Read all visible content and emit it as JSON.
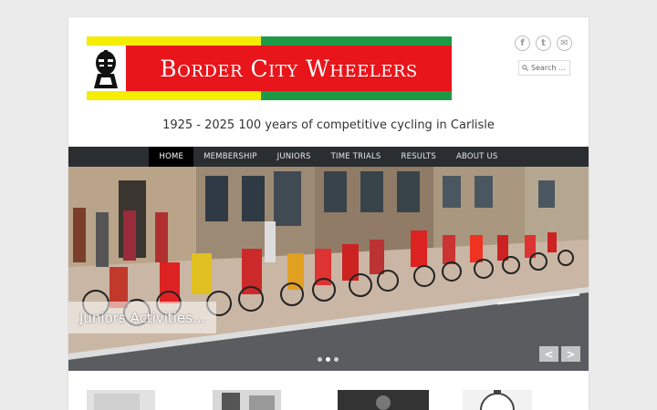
{
  "site": {
    "title": "Border City Wheelers",
    "tagline": "1925 - 2025 100 years of competitive cycling in Carlisle"
  },
  "social": [
    {
      "name": "facebook-icon",
      "glyph": "f"
    },
    {
      "name": "twitter-icon",
      "glyph": "t"
    },
    {
      "name": "email-icon",
      "glyph": "✉"
    }
  ],
  "search": {
    "placeholder": "Search ..."
  },
  "nav": [
    {
      "label": "HOME",
      "active": true
    },
    {
      "label": "MEMBERSHIP",
      "active": false
    },
    {
      "label": "JUNIORS",
      "active": false
    },
    {
      "label": "TIME TRIALS",
      "active": false
    },
    {
      "label": "RESULTS",
      "active": false
    },
    {
      "label": "ABOUT US",
      "active": false
    }
  ],
  "slider": {
    "caption": "Juniors Activities...",
    "prev_label": "<",
    "next_label": ">",
    "slide_count": 3,
    "current_slide": 2
  },
  "colors": {
    "banner_red": "#e8151b",
    "banner_yellow": "#f5ec00",
    "banner_green": "#1e9a47",
    "nav_bg": "#2b2e31"
  }
}
